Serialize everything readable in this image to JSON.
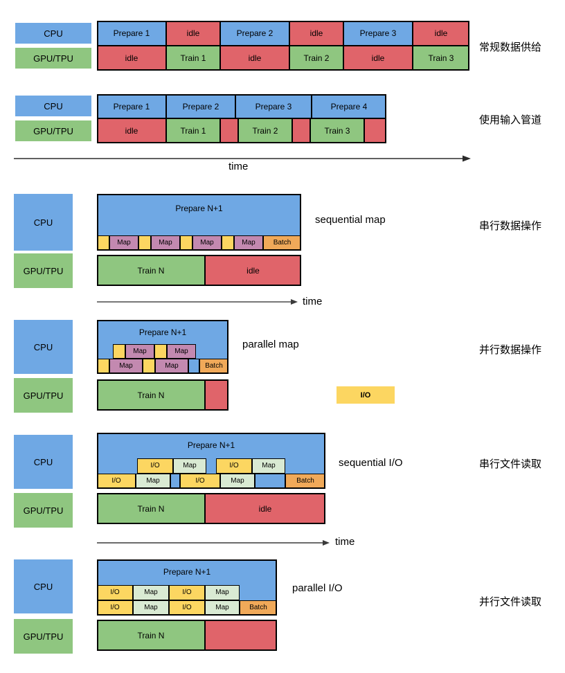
{
  "colors": {
    "cpu_blue": "#6fa8e4",
    "gpu_green": "#8fc680",
    "idle_red": "#e0646a",
    "map_purple": "#c389b0",
    "io_yellow": "#fcd661",
    "batch_orange": "#f0a959",
    "map_mint": "#d9ead3"
  },
  "legend": {
    "cpu": "CPU",
    "gpu": "GPU/TPU"
  },
  "axis": {
    "time": "time"
  },
  "io_key": {
    "label": "I/O"
  },
  "sections": [
    {
      "id": "naive",
      "cn_label": "常规数据供给",
      "caption": "",
      "cpu_row": [
        {
          "text": "Prepare 1",
          "color": "blue"
        },
        {
          "text": "idle",
          "color": "red"
        },
        {
          "text": "Prepare 2",
          "color": "blue"
        },
        {
          "text": "idle",
          "color": "red"
        },
        {
          "text": "Prepare 3",
          "color": "blue"
        },
        {
          "text": "idle",
          "color": "red"
        }
      ],
      "gpu_row": [
        {
          "text": "idle",
          "color": "red"
        },
        {
          "text": "Train 1",
          "color": "green"
        },
        {
          "text": "idle",
          "color": "red"
        },
        {
          "text": "Train 2",
          "color": "green"
        },
        {
          "text": "idle",
          "color": "red"
        },
        {
          "text": "Train 3",
          "color": "green"
        }
      ]
    },
    {
      "id": "pipelined",
      "cn_label": "使用输入管道",
      "caption": "",
      "cpu_row": [
        {
          "text": "Prepare 1",
          "color": "blue"
        },
        {
          "text": "Prepare 2",
          "color": "blue"
        },
        {
          "text": "Prepare 3",
          "color": "blue"
        },
        {
          "text": "Prepare 4",
          "color": "blue"
        }
      ],
      "gpu_row": [
        {
          "text": "idle",
          "color": "red"
        },
        {
          "text": "Train 1",
          "color": "green"
        },
        {
          "text": "",
          "color": "red"
        },
        {
          "text": "Train 2",
          "color": "green"
        },
        {
          "text": "",
          "color": "red"
        },
        {
          "text": "Train 3",
          "color": "green"
        },
        {
          "text": "",
          "color": "red"
        }
      ]
    },
    {
      "id": "sequential-map",
      "cn_label": "串行数据操作",
      "caption": "sequential map",
      "prepare_label": "Prepare N+1",
      "train_label": "Train N",
      "idle_label": "idle",
      "sub_row": [
        {
          "text": "",
          "color": "yellow"
        },
        {
          "text": "Map",
          "color": "purple"
        },
        {
          "text": "",
          "color": "yellow"
        },
        {
          "text": "Map",
          "color": "purple"
        },
        {
          "text": "",
          "color": "yellow"
        },
        {
          "text": "Map",
          "color": "purple"
        },
        {
          "text": "",
          "color": "yellow"
        },
        {
          "text": "Map",
          "color": "purple"
        },
        {
          "text": "Batch",
          "color": "orange"
        }
      ]
    },
    {
      "id": "parallel-map",
      "cn_label": "并行数据操作",
      "caption": "parallel map",
      "prepare_label": "Prepare N+1",
      "train_label": "Train N",
      "sub_row_top": [
        {
          "text": "",
          "color": "yellow"
        },
        {
          "text": "Map",
          "color": "purple"
        },
        {
          "text": "",
          "color": "yellow"
        },
        {
          "text": "Map",
          "color": "purple"
        }
      ],
      "sub_row_bottom": [
        {
          "text": "",
          "color": "yellow"
        },
        {
          "text": "Map",
          "color": "purple"
        },
        {
          "text": "",
          "color": "yellow"
        },
        {
          "text": "Map",
          "color": "purple"
        },
        {
          "text": "",
          "color": "blue"
        },
        {
          "text": "Batch",
          "color": "orange"
        }
      ]
    },
    {
      "id": "sequential-io",
      "cn_label": "串行文件读取",
      "caption": "sequential I/O",
      "prepare_label": "Prepare N+1",
      "train_label": "Train N",
      "idle_label": "idle",
      "sub_row_top": [
        {
          "text": "I/O",
          "color": "yellow"
        },
        {
          "text": "Map",
          "color": "mint"
        },
        {
          "text": "I/O",
          "color": "yellow"
        },
        {
          "text": "Map",
          "color": "mint"
        }
      ],
      "sub_row_bottom": [
        {
          "text": "I/O",
          "color": "yellow"
        },
        {
          "text": "Map",
          "color": "mint"
        },
        {
          "text": "I/O",
          "color": "yellow"
        },
        {
          "text": "Map",
          "color": "mint"
        },
        {
          "text": "Batch",
          "color": "orange"
        }
      ]
    },
    {
      "id": "parallel-io",
      "cn_label": "并行文件读取",
      "caption": "parallel I/O",
      "prepare_label": "Prepare N+1",
      "train_label": "Train N",
      "sub_row_top": [
        {
          "text": "I/O",
          "color": "yellow"
        },
        {
          "text": "Map",
          "color": "mint"
        },
        {
          "text": "I/O",
          "color": "yellow"
        },
        {
          "text": "Map",
          "color": "mint"
        }
      ],
      "sub_row_bottom": [
        {
          "text": "I/O",
          "color": "yellow"
        },
        {
          "text": "Map",
          "color": "mint"
        },
        {
          "text": "I/O",
          "color": "yellow"
        },
        {
          "text": "Map",
          "color": "mint"
        },
        {
          "text": "Batch",
          "color": "orange"
        }
      ]
    }
  ]
}
